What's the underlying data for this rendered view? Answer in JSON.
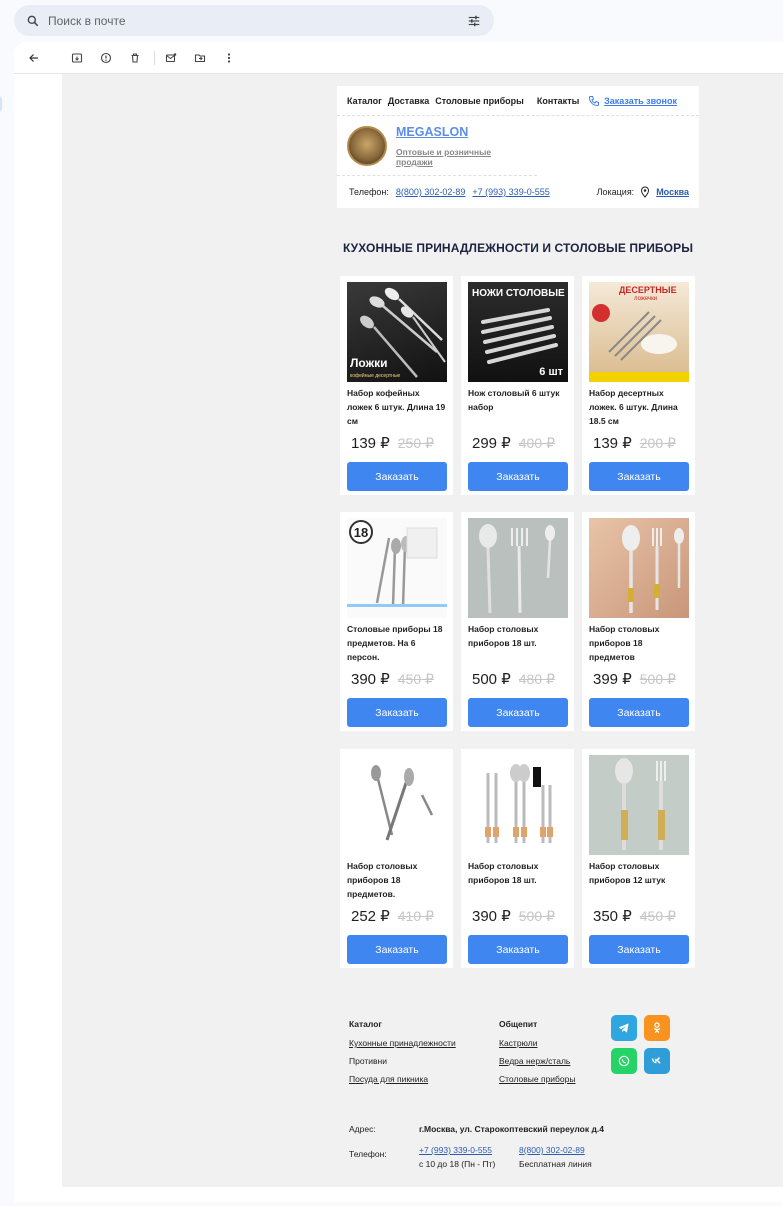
{
  "search": {
    "placeholder": "Поиск в почте"
  },
  "nav": {
    "items": [
      "Каталог",
      "Доставка",
      "Столовые приборы",
      "Контакты"
    ],
    "call": "Заказать звонок"
  },
  "brand": {
    "name": "MEGASLON",
    "tagline": "Оптовые и розничные продажи"
  },
  "contacts": {
    "phone_label": "Телефон:",
    "phone1": "8(800) 302-02-89",
    "phone2": "+7 (993) 339-0-555",
    "location_label": "Локация:",
    "city": "Москва"
  },
  "section_title": "КУХОННЫЕ ПРИНАДЛЕЖНОСТИ И СТОЛОВЫЕ ПРИБОРЫ",
  "products": [
    {
      "name": "Набор кофейных ложек 6 штук. Длина 19 см",
      "price": "139 ₽",
      "old": "250 ₽",
      "img_text": "Ложки",
      "img_sub": "кофейные  десертные"
    },
    {
      "name": "Нож столовый 6 штук набор",
      "price": "299 ₽",
      "old": "400 ₽",
      "img_text": "НОЖИ СТОЛОВЫЕ",
      "img_sub": "6 шт"
    },
    {
      "name": "Набор десертных ложек. 6 штук. Длина 18.5 см",
      "price": "139 ₽",
      "old": "200 ₽",
      "img_text": "ДЕСЕРТНЫЕ",
      "img_sub": "ложечки"
    },
    {
      "name": "Столовые приборы 18 предметов. На 6 персон.",
      "price": "390 ₽",
      "old": "450 ₽",
      "img_text": "18",
      "img_sub": ""
    },
    {
      "name": "Набор столовых приборов 18 шт.",
      "price": "500 ₽",
      "old": "480 ₽",
      "img_text": "",
      "img_sub": ""
    },
    {
      "name": "Набор столовых приборов 18 предметов",
      "price": "399 ₽",
      "old": "500 ₽",
      "img_text": "",
      "img_sub": ""
    },
    {
      "name": "Набор столовых приборов 18 предметов.",
      "price": "252 ₽",
      "old": "410 ₽",
      "img_text": "",
      "img_sub": ""
    },
    {
      "name": "Набор столовых приборов 18 шт.",
      "price": "390 ₽",
      "old": "500 ₽",
      "img_text": "",
      "img_sub": ""
    },
    {
      "name": "Набор столовых приборов 12 штук",
      "price": "350 ₽",
      "old": "450 ₽",
      "img_text": "",
      "img_sub": ""
    }
  ],
  "order_label": "Заказать",
  "footer": {
    "col1": {
      "title": "Каталог",
      "items": [
        "Кухонные принадлежности",
        "Противни",
        "Посуда для пикника"
      ]
    },
    "col2": {
      "title": "Общепит",
      "items": [
        "Кастрюли",
        "Ведра нерж/сталь",
        "Столовые приборы"
      ]
    },
    "address_label": "Адрес:",
    "address": "г.Москва, ул. Старокоптевский переулок д.4",
    "phone_label": "Телефон:",
    "phone1": "+7 (993) 339-0-555",
    "phone1_note": "с 10 до 18 (Пн - Пт)",
    "phone2": "8(800) 302-02-89",
    "phone2_note": "Бесплатная линия"
  },
  "colors": {
    "accent": "#3f86f0",
    "link": "#2a5db0",
    "telegram": "#2ea6df",
    "odnoklassniki": "#f7931e",
    "whatsapp": "#25d366",
    "vk": "#2f9ed8"
  }
}
